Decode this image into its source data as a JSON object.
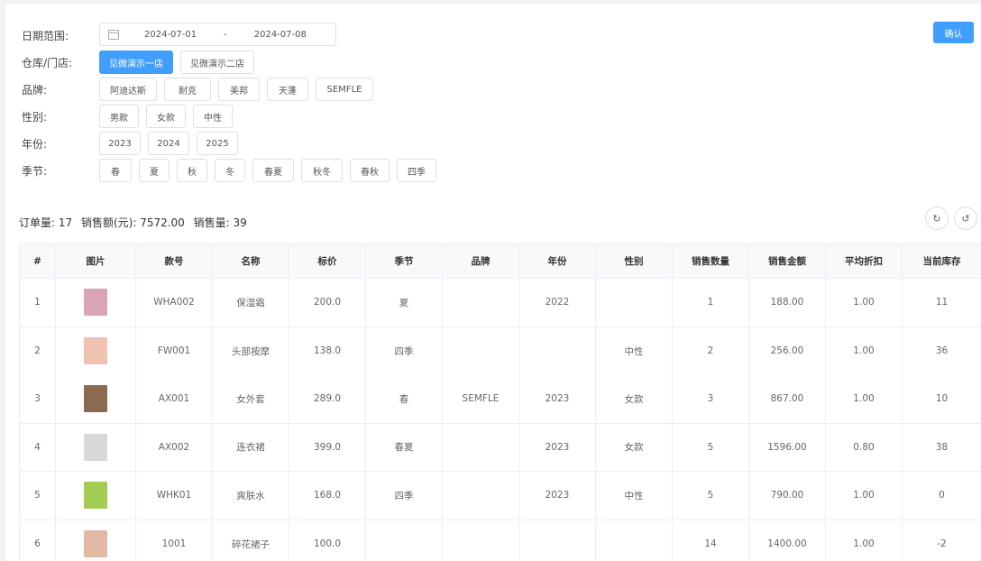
{
  "filters": {
    "date": {
      "label": "日期范围:",
      "start": "2024-07-01",
      "separator": "-",
      "end": "2024-07-08"
    },
    "confirm_label": "确认",
    "store": {
      "label": "仓库/门店:",
      "options": [
        "见微演示一店",
        "见微演示二店"
      ],
      "active": 0
    },
    "brand": {
      "label": "品牌:",
      "options": [
        "阿迪达斯",
        "耐克",
        "美邦",
        "天蓬",
        "SEMFLE"
      ]
    },
    "gender": {
      "label": "性别:",
      "options": [
        "男款",
        "女款",
        "中性"
      ]
    },
    "year": {
      "label": "年份:",
      "options": [
        "2023",
        "2024",
        "2025"
      ]
    },
    "season": {
      "label": "季节:",
      "options": [
        "春",
        "夏",
        "秋",
        "冬",
        "春夏",
        "秋冬",
        "春秋",
        "四季"
      ]
    }
  },
  "summary": {
    "orders": "订单量: 17",
    "amount": "销售额(元): 7572.00",
    "qty": "销售量: 39"
  },
  "toolbar": {
    "refresh_icon": "refresh-icon",
    "reload_icon": "reload-icon"
  },
  "table": {
    "headers": [
      "#",
      "图片",
      "款号",
      "名称",
      "标价",
      "季节",
      "品牌",
      "年份",
      "性别",
      "销售数量",
      "销售金额",
      "平均折扣",
      "当前库存"
    ],
    "rows": [
      {
        "idx": "1",
        "img": "#d9a5b3",
        "code": "WHA002",
        "name": "保湿霜",
        "price": "200.0",
        "season": "夏",
        "brand": "",
        "year": "2022",
        "gender": "",
        "qty": "1",
        "amount": "188.00",
        "disc": "1.00",
        "stock": "11"
      },
      {
        "idx": "2",
        "img": "#f0c2b4",
        "code": "FW001",
        "name": "头部按摩",
        "price": "138.0",
        "season": "四季",
        "brand": "",
        "year": "",
        "gender": "中性",
        "qty": "2",
        "amount": "256.00",
        "disc": "1.00",
        "stock": "36"
      },
      {
        "idx": "3",
        "img": "#8b6a52",
        "code": "AX001",
        "name": "女外套",
        "price": "289.0",
        "season": "春",
        "brand": "SEMFLE",
        "year": "2023",
        "gender": "女款",
        "qty": "3",
        "amount": "867.00",
        "disc": "1.00",
        "stock": "10"
      },
      {
        "idx": "4",
        "img": "#d8d8dc",
        "code": "AX002",
        "name": "连衣裙",
        "price": "399.0",
        "season": "春夏",
        "brand": "",
        "year": "2023",
        "gender": "女款",
        "qty": "5",
        "amount": "1596.00",
        "disc": "0.80",
        "stock": "38"
      },
      {
        "idx": "5",
        "img": "#a3cc55",
        "code": "WHK01",
        "name": "爽肤水",
        "price": "168.0",
        "season": "四季",
        "brand": "",
        "year": "2023",
        "gender": "中性",
        "qty": "5",
        "amount": "790.00",
        "disc": "1.00",
        "stock": "0"
      },
      {
        "idx": "6",
        "img": "#e3b9a6",
        "code": "1001",
        "name": "碎花裙子",
        "price": "100.0",
        "season": "",
        "brand": "",
        "year": "",
        "gender": "",
        "qty": "14",
        "amount": "1400.00",
        "disc": "1.00",
        "stock": "-2"
      }
    ]
  }
}
